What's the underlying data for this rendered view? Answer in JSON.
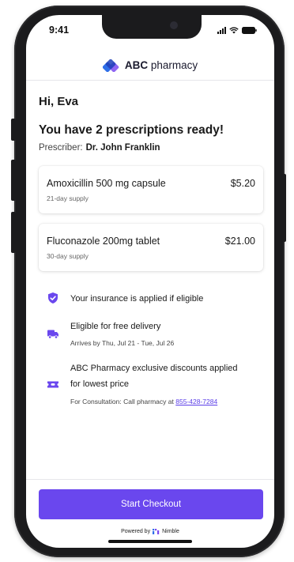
{
  "status_bar": {
    "time": "9:41"
  },
  "header": {
    "brand_bold": "ABC",
    "brand_rest": " pharmacy",
    "logo_icon": "abc-pharmacy-logo-icon"
  },
  "greeting": "Hi, Eva",
  "summary": {
    "title": "You have 2 prescriptions ready!",
    "prescriber_label": "Prescriber:",
    "prescriber_name": "Dr. John Franklin"
  },
  "prescriptions": [
    {
      "name": "Amoxicillin 500 mg capsule",
      "price": "$5.20",
      "supply": "21-day supply"
    },
    {
      "name": "Fluconazole 200mg tablet",
      "price": "$21.00",
      "supply": "30-day supply"
    }
  ],
  "info": {
    "insurance": {
      "text": "Your insurance is applied if eligible",
      "icon": "shield-check-icon"
    },
    "delivery": {
      "text": "Eligible for free delivery",
      "sub": "Arrives by Thu, Jul 21 - Tue, Jul 26",
      "icon": "truck-icon"
    },
    "discount": {
      "text_line1": "ABC Pharmacy exclusive discounts applied",
      "text_line2": "for lowest price",
      "sub_prefix": "For Consultation: Call pharmacy at ",
      "phone": "855-428-7284",
      "icon": "ticket-icon"
    }
  },
  "checkout": {
    "label": "Start Checkout"
  },
  "powered_by": {
    "prefix": "Powered by",
    "brand": "Nimble"
  },
  "colors": {
    "accent": "#6a47ee",
    "link": "#5b3ee8",
    "logo_blue": "#2f6fe8",
    "logo_purple": "#7b4af0"
  }
}
